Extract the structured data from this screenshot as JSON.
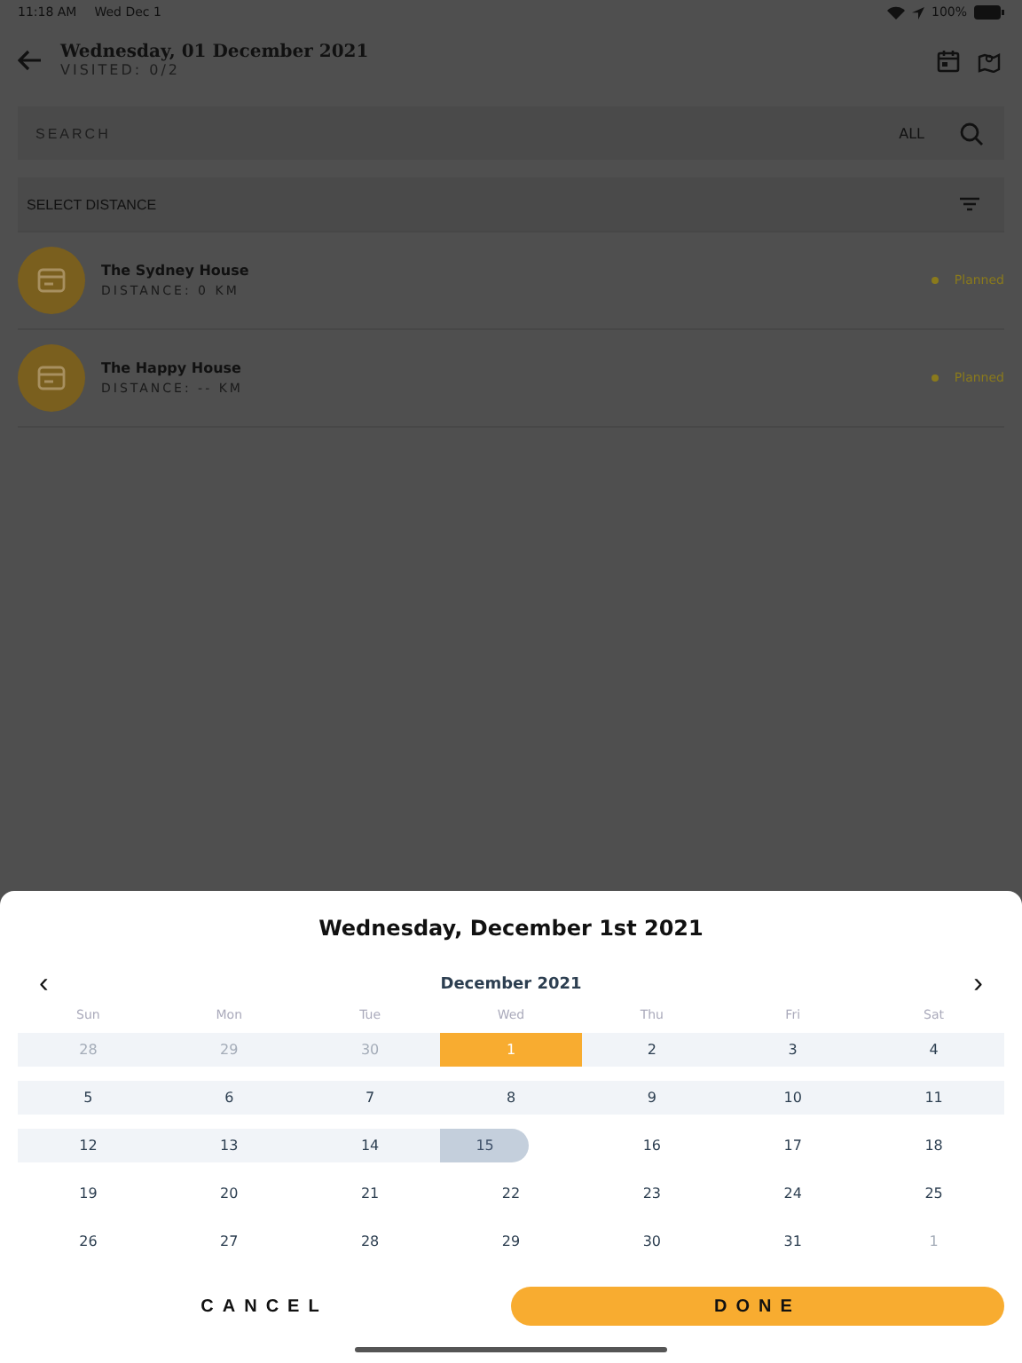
{
  "status_bar": {
    "time": "11:18 AM",
    "date": "Wed Dec 1",
    "battery": "100%"
  },
  "header": {
    "title": "Wednesday, 01 December 2021",
    "subtitle": "VISITED: 0/2"
  },
  "search": {
    "placeholder": "SEARCH",
    "filter": "ALL"
  },
  "distance_select": {
    "label": "SELECT DISTANCE"
  },
  "places": [
    {
      "name": "The Sydney House",
      "distance": "DISTANCE: 0 KM",
      "status": "Planned",
      "color": "#8a7a1c"
    },
    {
      "name": "The Happy House",
      "distance": "DISTANCE: -- KM",
      "status": "Planned",
      "color": "#8a7a1c"
    }
  ],
  "date_picker": {
    "title": "Wednesday, December 1st 2021",
    "month": "December 2021",
    "prev": "‹",
    "next": "›",
    "weekdays": [
      "Sun",
      "Mon",
      "Tue",
      "Wed",
      "Thu",
      "Fri",
      "Sat"
    ],
    "weeks": [
      [
        {
          "day": "28",
          "kind": "outside_shaded"
        },
        {
          "day": "29",
          "kind": "outside_shaded"
        },
        {
          "day": "30",
          "kind": "outside_shaded"
        },
        {
          "day": "1",
          "kind": "selected"
        },
        {
          "day": "2",
          "kind": "shaded"
        },
        {
          "day": "3",
          "kind": "shaded"
        },
        {
          "day": "4",
          "kind": "shaded"
        }
      ],
      [
        {
          "day": "5",
          "kind": "shaded"
        },
        {
          "day": "6",
          "kind": "shaded"
        },
        {
          "day": "7",
          "kind": "shaded"
        },
        {
          "day": "8",
          "kind": "shaded"
        },
        {
          "day": "9",
          "kind": "shaded"
        },
        {
          "day": "10",
          "kind": "shaded"
        },
        {
          "day": "11",
          "kind": "shaded"
        }
      ],
      [
        {
          "day": "12",
          "kind": "shaded"
        },
        {
          "day": "13",
          "kind": "shaded"
        },
        {
          "day": "14",
          "kind": "shaded"
        },
        {
          "day": "15",
          "kind": "today"
        },
        {
          "day": "16",
          "kind": "normal"
        },
        {
          "day": "17",
          "kind": "normal"
        },
        {
          "day": "18",
          "kind": "normal"
        }
      ],
      [
        {
          "day": "19",
          "kind": "normal"
        },
        {
          "day": "20",
          "kind": "normal"
        },
        {
          "day": "21",
          "kind": "normal"
        },
        {
          "day": "22",
          "kind": "normal"
        },
        {
          "day": "23",
          "kind": "normal"
        },
        {
          "day": "24",
          "kind": "normal"
        },
        {
          "day": "25",
          "kind": "normal"
        }
      ],
      [
        {
          "day": "26",
          "kind": "normal"
        },
        {
          "day": "27",
          "kind": "normal"
        },
        {
          "day": "28",
          "kind": "normal"
        },
        {
          "day": "29",
          "kind": "normal"
        },
        {
          "day": "30",
          "kind": "normal"
        },
        {
          "day": "31",
          "kind": "normal"
        },
        {
          "day": "1",
          "kind": "outside"
        }
      ]
    ],
    "cancel": "CANCEL",
    "done": "DONE"
  }
}
